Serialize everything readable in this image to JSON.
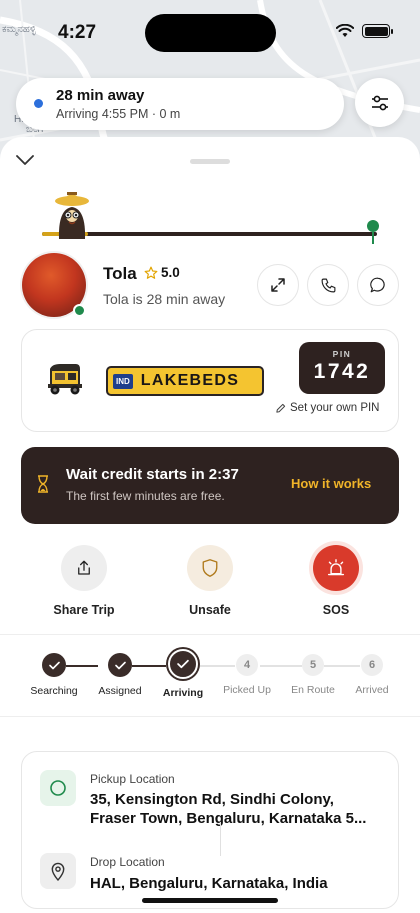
{
  "status_bar": {
    "time": "4:27"
  },
  "map": {
    "labels": [
      "ಕಮ್ಮನಹಳ್ಳಿ",
      "HE",
      "ಬೆಂಗ"
    ]
  },
  "eta_pill": {
    "title": "28 min away",
    "subtitle": "Arriving 4:55 PM · 0 m"
  },
  "driver": {
    "name": "Tola",
    "rating": "5.0",
    "status_text": "Tola is 28 min away"
  },
  "vehicle": {
    "plate_country": "IND",
    "plate_number": "LAKEBEDS",
    "pin_label": "PIN",
    "pin_value": "1742",
    "set_pin_label": "Set your own PIN"
  },
  "wait_banner": {
    "title": "Wait credit starts in 2:37",
    "subtitle": "The first few minutes are free.",
    "link": "How it works"
  },
  "actions": [
    {
      "label": "Share Trip",
      "icon": "share-icon"
    },
    {
      "label": "Unsafe",
      "icon": "shield-icon"
    },
    {
      "label": "SOS",
      "icon": "siren-icon"
    }
  ],
  "steps": [
    {
      "label": "Searching",
      "state": "done"
    },
    {
      "label": "Assigned",
      "state": "done"
    },
    {
      "label": "Arriving",
      "state": "active"
    },
    {
      "label": "Picked Up",
      "state": "future",
      "number": "4"
    },
    {
      "label": "En Route",
      "state": "future",
      "number": "5"
    },
    {
      "label": "Arrived",
      "state": "future",
      "number": "6"
    }
  ],
  "locations": {
    "pickup_label": "Pickup Location",
    "pickup_value": "35, Kensington Rd, Sindhi Colony, Fraser Town, Bengaluru, Karnataka 5...",
    "drop_label": "Drop Location",
    "drop_value": "HAL, Bengaluru, Karnataka, India"
  },
  "colors": {
    "brand_dark": "#2e2220",
    "accent_yellow": "#f0b429",
    "sos_red": "#d93a2b",
    "online_green": "#1f8a4c",
    "eta_blue": "#2c6fdb"
  }
}
